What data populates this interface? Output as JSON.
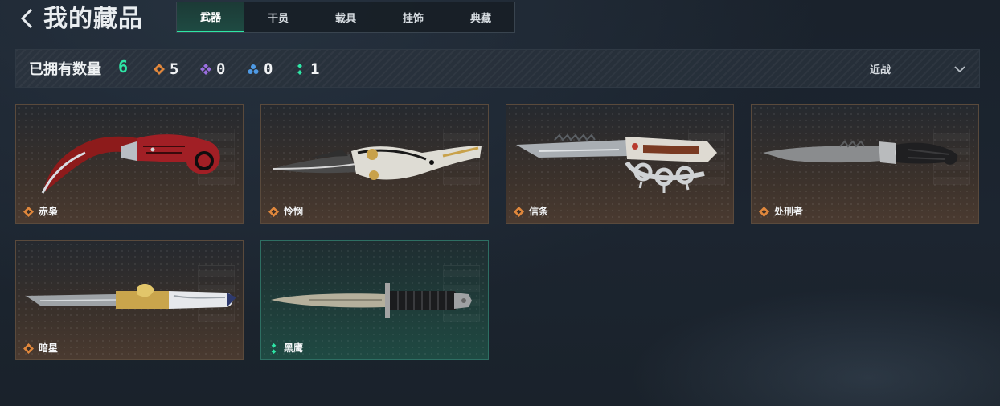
{
  "header": {
    "title": "我的藏品",
    "tabs": [
      {
        "label": "武器",
        "active": true
      },
      {
        "label": "干员",
        "active": false
      },
      {
        "label": "载具",
        "active": false
      },
      {
        "label": "挂饰",
        "active": false
      },
      {
        "label": "典藏",
        "active": false
      }
    ]
  },
  "summary": {
    "owned_label": "已拥有数量",
    "owned_count": "6",
    "stats": [
      {
        "icon": "orange-diamond-icon",
        "value": "5",
        "color": "#e0873c"
      },
      {
        "icon": "purple-diamond-icon",
        "value": "0",
        "color": "#9a6ee0"
      },
      {
        "icon": "blue-triangle-icon",
        "value": "0",
        "color": "#4f9be6"
      },
      {
        "icon": "green-dots-icon",
        "value": "1",
        "color": "#2ee6a6"
      }
    ],
    "filter_label": "近战"
  },
  "colors": {
    "accent_green": "#2ee6a6",
    "rarity_orange": "#e0873c"
  },
  "items": [
    {
      "name": "赤枭",
      "rarity": "orange",
      "weapon": "karambit"
    },
    {
      "name": "怜悯",
      "rarity": "orange",
      "weapon": "ornate-folding-knife"
    },
    {
      "name": "信条",
      "rarity": "orange",
      "weapon": "knuckle-knife"
    },
    {
      "name": "处刑者",
      "rarity": "orange",
      "weapon": "tactical-knife"
    },
    {
      "name": "暗星",
      "rarity": "orange",
      "weapon": "ornate-straight-blade"
    },
    {
      "name": "黑鹰",
      "rarity": "green",
      "weapon": "combat-dagger"
    }
  ]
}
